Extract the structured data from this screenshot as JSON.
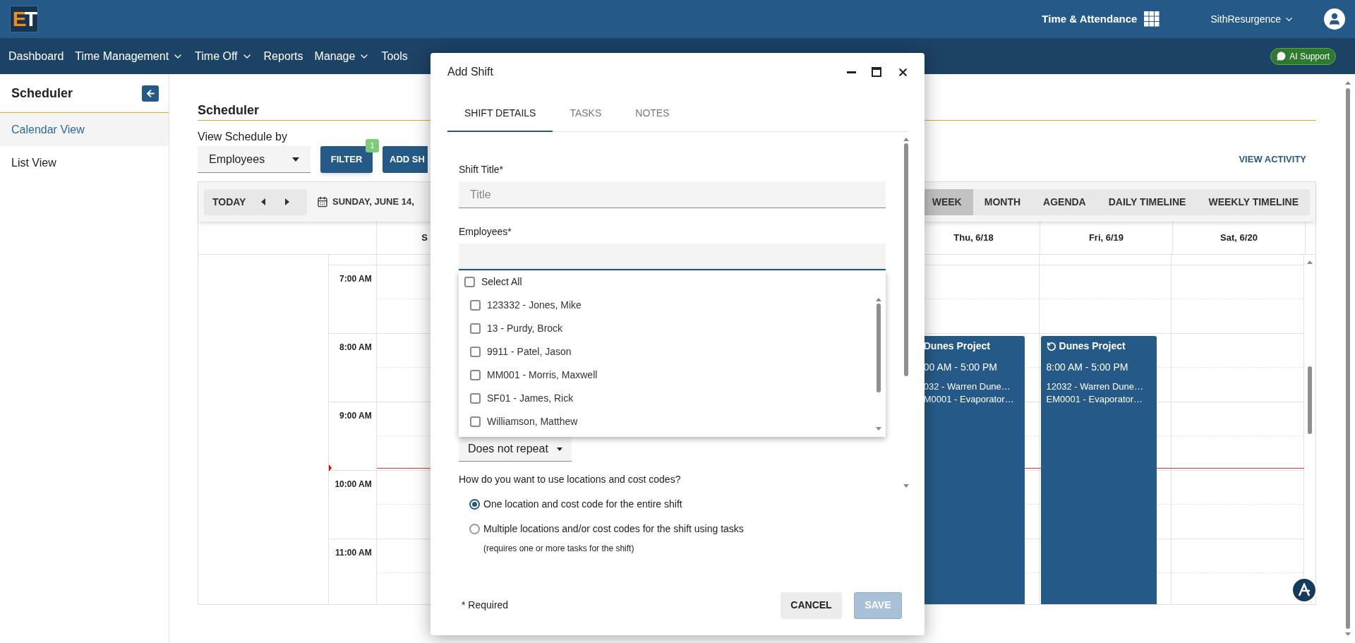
{
  "app": {
    "logo": [
      "E",
      "T"
    ],
    "product": "Time & Attendance",
    "user": "SithResurgence"
  },
  "nav": [
    {
      "label": "Dashboard",
      "has_menu": false
    },
    {
      "label": "Time Management",
      "has_menu": true
    },
    {
      "label": "Time Off",
      "has_menu": true
    },
    {
      "label": "Reports",
      "has_menu": false
    },
    {
      "label": "Manage",
      "has_menu": true
    },
    {
      "label": "Tools",
      "has_menu": false
    }
  ],
  "ai_support": "AI Support",
  "sidebar": {
    "title": "Scheduler",
    "items": [
      {
        "label": "Calendar View",
        "selected": true
      },
      {
        "label": "List View",
        "selected": false
      }
    ]
  },
  "page": {
    "title": "Scheduler",
    "view_by_label": "View Schedule by",
    "view_by_value": "Employees",
    "filter_button": "FILTER",
    "filter_count": "1",
    "add_button": "ADD SH",
    "view_activity": "VIEW ACTIVITY"
  },
  "calendar": {
    "today": "TODAY",
    "date": "SUNDAY, JUNE 14,",
    "views": [
      {
        "label": "WEEK",
        "selected": true
      },
      {
        "label": "MONTH",
        "selected": false
      },
      {
        "label": "AGENDA",
        "selected": false
      },
      {
        "label": "DAILY TIMELINE",
        "selected": false
      },
      {
        "label": "WEEKLY TIMELINE",
        "selected": false
      }
    ],
    "times": [
      "7:00 AM",
      "8:00 AM",
      "9:00 AM",
      "10:00 AM",
      "11:00 AM"
    ],
    "days": [
      {
        "label": "S"
      },
      {
        "label": "Thu, 6/18",
        "events": [
          {
            "kind": "clipped",
            "recurring": false,
            "title": "Dunes Project",
            "time": "00 AM - 5:00 PM",
            "lines": [
              "032 - Warren Dune…",
              "M0001 - Evaporator…"
            ]
          }
        ]
      },
      {
        "label": "Fri, 6/19",
        "events": [
          {
            "kind": "full",
            "recurring": true,
            "title": "Dunes Project",
            "time": "8:00 AM - 5:00 PM",
            "lines": [
              "12032 - Warren Dune…",
              "EM0001 - Evaporator…"
            ]
          }
        ]
      },
      {
        "label": "Sat, 6/20"
      }
    ]
  },
  "dialog": {
    "title": "Add Shift",
    "tabs": [
      {
        "label": "SHIFT DETAILS",
        "selected": true
      },
      {
        "label": "TASKS",
        "selected": false
      },
      {
        "label": "NOTES",
        "selected": false
      }
    ],
    "shift_title": {
      "label": "Shift Title*",
      "placeholder": "Title"
    },
    "employees": {
      "label": "Employees*",
      "select_all": {
        "label": "Select All",
        "checked": false
      },
      "options": [
        {
          "label": "123332 - Jones, Mike",
          "checked": false
        },
        {
          "label": "13 - Purdy, Brock",
          "checked": false
        },
        {
          "label": "9911 - Patel, Jason",
          "checked": false
        },
        {
          "label": "MM001 - Morris, Maxwell",
          "checked": false
        },
        {
          "label": "SF01 - James, Rick",
          "checked": false
        },
        {
          "label": "Williamson, Matthew",
          "checked": false
        }
      ]
    },
    "repeat": "Does not repeat",
    "question": "How do you want to use locations and cost codes?",
    "options": [
      {
        "label": "One location and cost code for the entire shift",
        "selected": true
      },
      {
        "label": "Multiple locations and/or cost codes for the shift using tasks",
        "selected": false,
        "note": "(requires one or more tasks for the shift)"
      }
    ],
    "required_note": "* Required",
    "cancel": "CANCEL",
    "save": "SAVE",
    "save_disabled": true
  }
}
